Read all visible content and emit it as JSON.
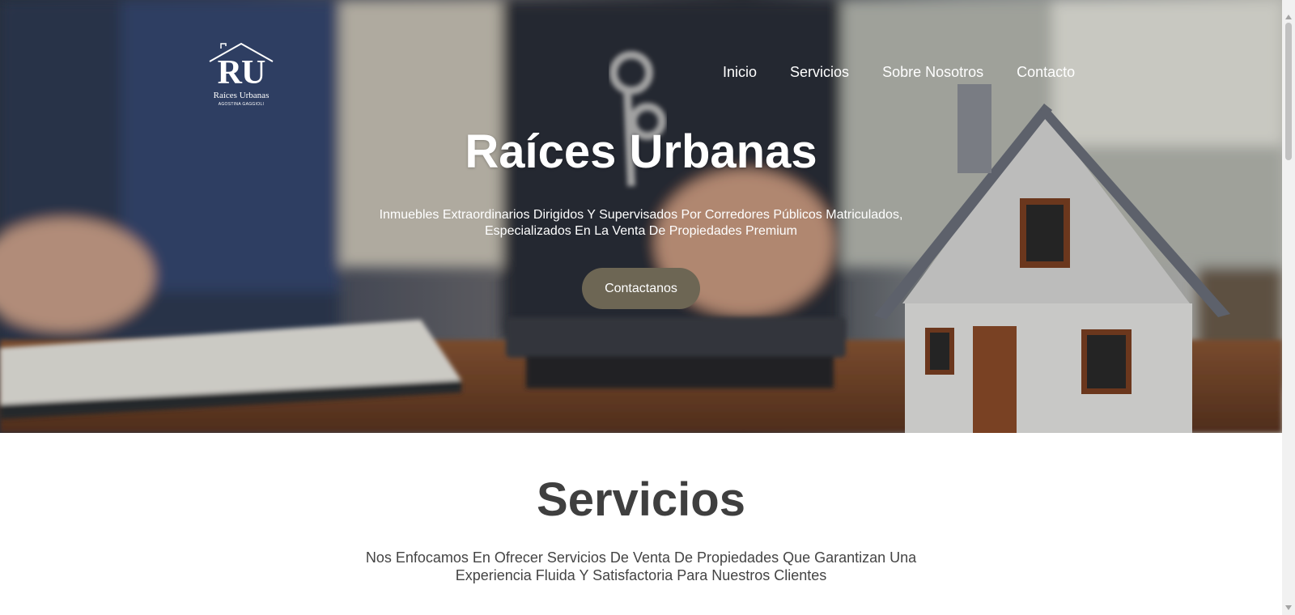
{
  "logo": {
    "monogram": "RU",
    "brand": "Raíces Urbanas",
    "agent": "AGOSTINA GAGGIOLI"
  },
  "nav": {
    "items": [
      {
        "label": "Inicio"
      },
      {
        "label": "Servicios"
      },
      {
        "label": "Sobre Nosotros"
      },
      {
        "label": "Contacto"
      }
    ]
  },
  "hero": {
    "title": "Raíces Urbanas",
    "subtitle": "Inmuebles Extraordinarios Dirigidos Y Supervisados Por Corredores Públicos Matriculados, Especializados En La Venta De Propiedades Premium",
    "cta_label": "Contactanos"
  },
  "services": {
    "title": "Servicios",
    "description": "Nos Enfocamos En Ofrecer Servicios De Venta De Propiedades Que Garantizan Una Experiencia Fluida Y Satisfactoria Para Nuestros Clientes"
  },
  "colors": {
    "cta": "#6d6654",
    "heading": "#3f3f3f"
  }
}
